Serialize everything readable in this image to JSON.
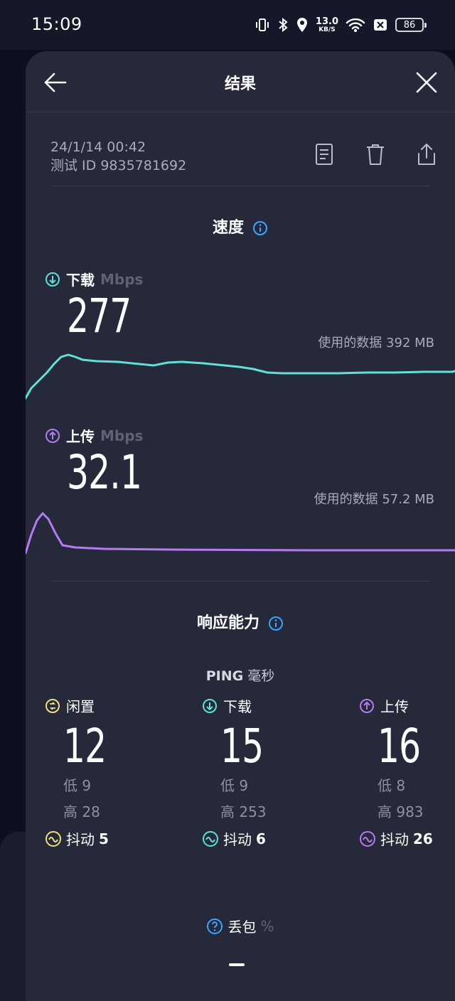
{
  "status_bar": {
    "time": "15:09",
    "net_speed_value": "13.0",
    "net_speed_unit": "KB/S",
    "battery": "86"
  },
  "header": {
    "title": "结果"
  },
  "test_info": {
    "datetime": "24/1/14 00:42",
    "test_id": "测试 ID 9835781692"
  },
  "speed": {
    "title": "速度",
    "download": {
      "label": "下载",
      "unit": "Mbps",
      "value": "277",
      "data_used": "使用的数据 392 MB",
      "color": "#5fe0d8"
    },
    "upload": {
      "label": "上传",
      "unit": "Mbps",
      "value": "32.1",
      "data_used": "使用的数据 57.2 MB",
      "color": "#b57bf2"
    }
  },
  "responsiveness": {
    "title": "响应能力",
    "ping_label": "PING",
    "ping_unit": "毫秒",
    "columns": [
      {
        "label": "闲置",
        "value": "12",
        "low": "低 9",
        "high": "高 28",
        "jitter_label": "抖动",
        "jitter_value": "5",
        "color": "#f1e07a",
        "icon": "idle-icon"
      },
      {
        "label": "下载",
        "value": "15",
        "low": "低 9",
        "high": "高 253",
        "jitter_label": "抖动",
        "jitter_value": "6",
        "color": "#5fe0d8",
        "icon": "download-icon"
      },
      {
        "label": "上传",
        "value": "16",
        "low": "低 8",
        "high": "高 983",
        "jitter_label": "抖动",
        "jitter_value": "26",
        "color": "#b57bf2",
        "icon": "upload-icon"
      }
    ],
    "packet_loss_label": "丢包",
    "packet_loss_unit": "%"
  }
}
